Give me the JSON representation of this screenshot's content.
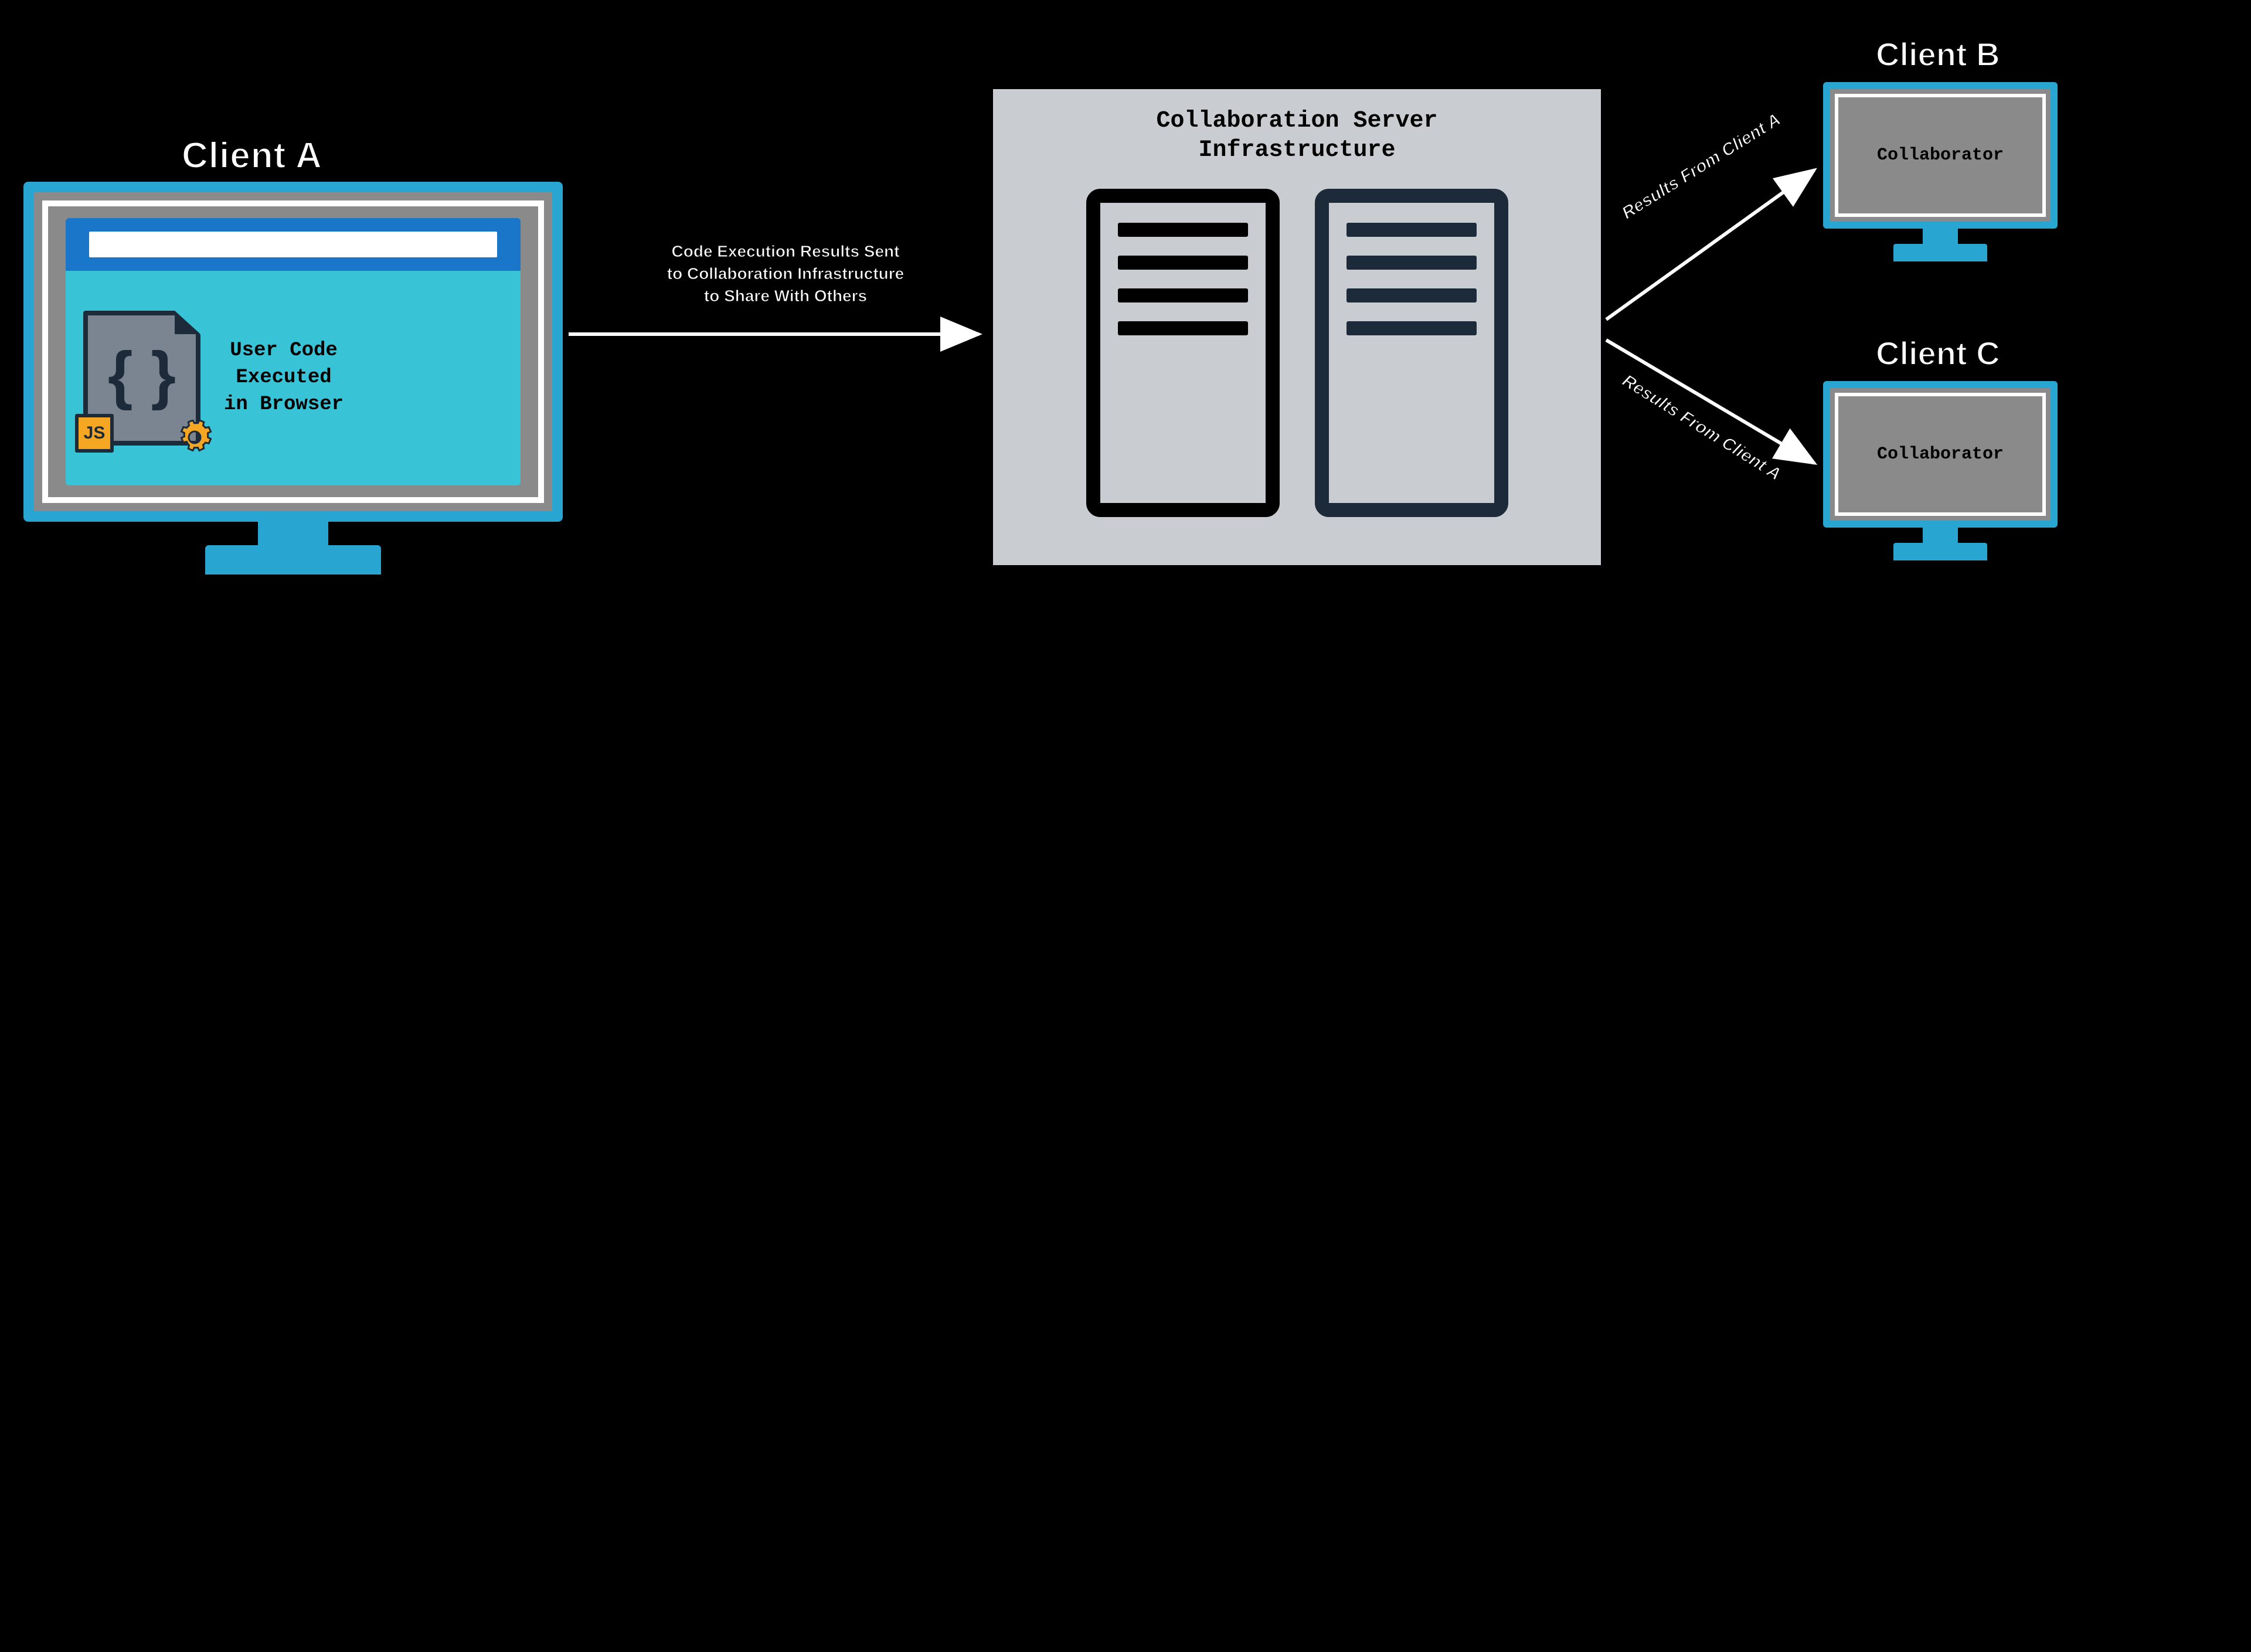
{
  "client_a": {
    "title": "Client A",
    "js_badge": "JS",
    "caption_line1": "User Code",
    "caption_line2": "Executed",
    "caption_line3": "in Browser"
  },
  "arrow_main": {
    "line1": "Code Execution Results Sent",
    "line2": "to Collaboration Infrastructure",
    "line3": "to Share With Others"
  },
  "server": {
    "title_line1": "Collaboration Server",
    "title_line2": "Infrastructure"
  },
  "edge_to_b": "Results From Client A",
  "edge_to_c": "Results From Client A",
  "client_b": {
    "title": "Client B",
    "label": "Collaborator"
  },
  "client_c": {
    "title": "Client C",
    "label": "Collaborator"
  },
  "colors": {
    "monitor_blue": "#29a5d1",
    "bezel_gray": "#8a8a8a",
    "browser_topbar": "#1976c9",
    "browser_body": "#38c3d6",
    "server_bg": "#c9cdd1",
    "rack_navy": "#1d2a3a",
    "js_badge": "#f5a623"
  }
}
